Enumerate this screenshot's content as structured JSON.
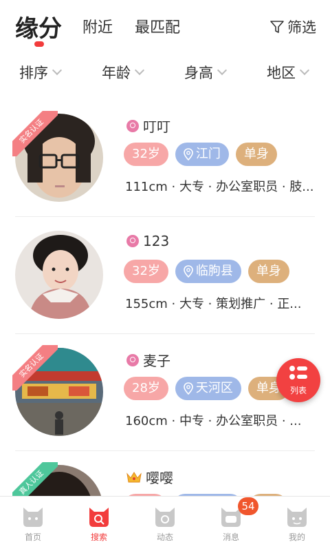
{
  "top_tabs": {
    "active": "缘分",
    "nearby": "附近",
    "best_match": "最匹配",
    "filter_label": "筛选"
  },
  "sort_bar": [
    "排序",
    "年龄",
    "身高",
    "地区"
  ],
  "users": [
    {
      "name": "叮叮",
      "badge": "实名认证",
      "age": "32岁",
      "location": "江门",
      "status": "单身",
      "details": "111cm · 大专 · 办公室职员 · 肢..."
    },
    {
      "name": "123",
      "badge": "",
      "age": "32岁",
      "location": "临朐县",
      "status": "单身",
      "details": "155cm · 大专 · 策划推广 · 正..."
    },
    {
      "name": "麦子",
      "badge": "实名认证",
      "age": "28岁",
      "location": "天河区",
      "status": "单身",
      "details": "160cm · 中专 · 办公室职员 · ..."
    },
    {
      "name": "嘤嘤",
      "badge": "真人认证",
      "age": "",
      "location": "",
      "status": "",
      "details": ""
    }
  ],
  "fab": {
    "label": "列表"
  },
  "bottom_nav": {
    "items": [
      "首页",
      "搜索",
      "动态",
      "消息",
      "我的"
    ],
    "active_index": 1,
    "message_badge": "54"
  },
  "colors": {
    "accent": "#f23c3c",
    "age_tag": "#f7a7a7",
    "location_tag": "#9fb8e8",
    "status_tag": "#ddb07c",
    "ribbon_real_name": "#f47f83",
    "ribbon_real_person": "#4ec79b"
  }
}
